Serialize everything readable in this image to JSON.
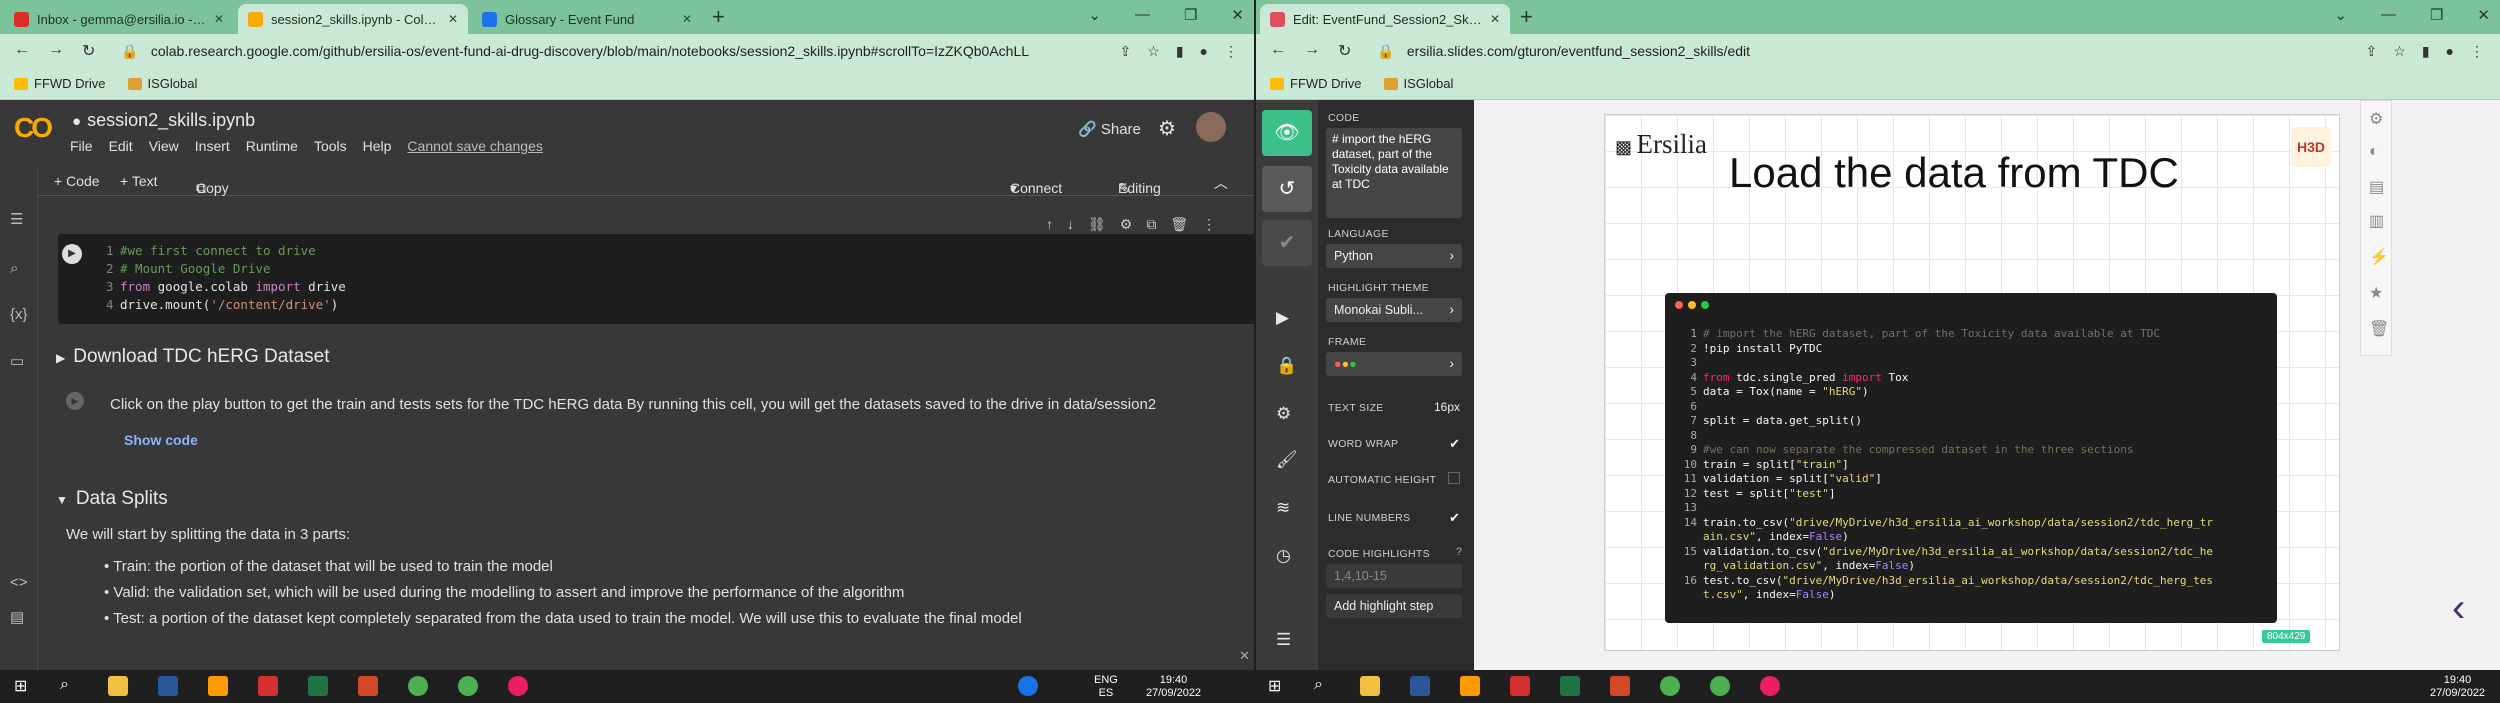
{
  "left_window": {
    "tabs": [
      {
        "title": "Inbox - gemma@ersilia.io - Ersil",
        "favicon_color": "#d93025"
      },
      {
        "title": "session2_skills.ipynb - Colaborat",
        "favicon_color": "#f9ab00"
      },
      {
        "title": "Glossary - Event Fund",
        "favicon_color": "#1a73e8"
      }
    ],
    "url": "colab.research.google.com/github/ersilia-os/event-fund-ai-drug-discovery/blob/main/notebooks/session2_skills.ipynb#scrollTo=IzZKQb0AchLL",
    "bookmarks": [
      "FFWD Drive",
      "ISGlobal"
    ],
    "colab": {
      "logo": "CO",
      "title": "session2_skills.ipynb",
      "menu": [
        "File",
        "Edit",
        "View",
        "Insert",
        "Runtime",
        "Tools",
        "Help"
      ],
      "unsaved": "Cannot save changes",
      "share": "Share",
      "toolbar": {
        "code": "+ Code",
        "text": "+ Text",
        "copy": "Copy to Drive",
        "connect": "Connect",
        "editing": "Editing"
      },
      "code_cell": [
        {
          "n": "1",
          "parts": [
            {
              "c": "cmt",
              "t": "#we first connect to drive"
            }
          ]
        },
        {
          "n": "2",
          "parts": [
            {
              "c": "cmt",
              "t": "# Mount Google Drive"
            }
          ]
        },
        {
          "n": "3",
          "parts": [
            {
              "c": "kw",
              "t": "from "
            },
            {
              "c": "",
              "t": "google.colab "
            },
            {
              "c": "kw",
              "t": "import "
            },
            {
              "c": "",
              "t": "drive"
            }
          ]
        },
        {
          "n": "4",
          "parts": [
            {
              "c": "",
              "t": "drive.mount("
            },
            {
              "c": "str",
              "t": "'/content/drive'"
            },
            {
              "c": "",
              "t": ")"
            }
          ]
        }
      ],
      "section1": "Download TDC hERG Dataset",
      "section1_text": "Click on the play button to get the train and tests sets for the TDC hERG data By running this cell, you will get the datasets saved to the drive in data/session2",
      "show_code": "Show code",
      "section2": "Data Splits",
      "section2_intro": "We will start by splitting the data in 3 parts:",
      "bullets": [
        "Train: the portion of the dataset that will be used to train the model",
        "Valid: the validation set, which will be used during the modelling to assert and improve the performance of the algorithm",
        "Test: a portion of the dataset kept completely separated from the data used to train the model. We will use this to evaluate the final model"
      ]
    }
  },
  "right_window": {
    "tab": "Edit: EventFund_Session2_Skills",
    "url": "ersilia.slides.com/gturon/eventfund_session2_skills/edit",
    "bookmarks": [
      "FFWD Drive",
      "ISGlobal"
    ],
    "props": {
      "code_label": "CODE",
      "code_preview": "# import the hERG dataset, part of the Toxicity data available at TDC",
      "language_label": "LANGUAGE",
      "language": "Python",
      "theme_label": "HIGHLIGHT THEME",
      "theme": "Monokai Subli...",
      "frame_label": "FRAME",
      "text_size_label": "TEXT SIZE",
      "text_size": "16px",
      "word_wrap": "WORD WRAP",
      "auto_height": "AUTOMATIC HEIGHT",
      "line_numbers": "LINE NUMBERS",
      "code_highlights": "CODE HIGHLIGHTS",
      "highlights_placeholder": "1,4,10-15",
      "add_step": "Add highlight step"
    },
    "slide": {
      "logo": "Ersilia",
      "badge": "H3D",
      "title": "Load the data from TDC",
      "size": "804x429",
      "code": [
        {
          "n": "1",
          "parts": [
            {
              "c": "mcm",
              "t": "# import the hERG dataset, part of the Toxicity data available at TDC"
            }
          ]
        },
        {
          "n": "2",
          "parts": [
            {
              "c": "",
              "t": "!pip install PyTDC"
            }
          ]
        },
        {
          "n": "3",
          "parts": []
        },
        {
          "n": "4",
          "parts": [
            {
              "c": "mkw",
              "t": "from "
            },
            {
              "c": "",
              "t": "tdc.single_pred "
            },
            {
              "c": "mkw",
              "t": "import "
            },
            {
              "c": "",
              "t": "Tox"
            }
          ]
        },
        {
          "n": "5",
          "parts": [
            {
              "c": "",
              "t": "data = Tox(name = "
            },
            {
              "c": "mst",
              "t": "\"hERG\""
            },
            {
              "c": "",
              "t": ")"
            }
          ]
        },
        {
          "n": "6",
          "parts": []
        },
        {
          "n": "7",
          "parts": [
            {
              "c": "",
              "t": "split = data.get_split()"
            }
          ]
        },
        {
          "n": "8",
          "parts": []
        },
        {
          "n": "9",
          "parts": [
            {
              "c": "mcm",
              "t": "#we can now separate the compressed dataset in the three sections"
            }
          ]
        },
        {
          "n": "10",
          "parts": [
            {
              "c": "",
              "t": "train = split["
            },
            {
              "c": "mst",
              "t": "\"train\""
            },
            {
              "c": "",
              "t": "]"
            }
          ]
        },
        {
          "n": "11",
          "parts": [
            {
              "c": "",
              "t": "validation = split["
            },
            {
              "c": "mst",
              "t": "\"valid\""
            },
            {
              "c": "",
              "t": "]"
            }
          ]
        },
        {
          "n": "12",
          "parts": [
            {
              "c": "",
              "t": "test = split["
            },
            {
              "c": "mst",
              "t": "\"test\""
            },
            {
              "c": "",
              "t": "]"
            }
          ]
        },
        {
          "n": "13",
          "parts": []
        },
        {
          "n": "14",
          "parts": [
            {
              "c": "",
              "t": "train.to_csv("
            },
            {
              "c": "mst",
              "t": "\"drive/MyDrive/h3d_ersilia_ai_workshop/data/session2/tdc_herg_tr"
            }
          ]
        },
        {
          "n": "",
          "parts": [
            {
              "c": "mst",
              "t": "ain.csv\""
            },
            {
              "c": "",
              "t": ", index="
            },
            {
              "c": "mnm",
              "t": "False"
            },
            {
              "c": "",
              "t": ")"
            }
          ]
        },
        {
          "n": "15",
          "parts": [
            {
              "c": "",
              "t": "validation.to_csv("
            },
            {
              "c": "mst",
              "t": "\"drive/MyDrive/h3d_ersilia_ai_workshop/data/session2/tdc_he"
            }
          ]
        },
        {
          "n": "",
          "parts": [
            {
              "c": "mst",
              "t": "rg_validation.csv\""
            },
            {
              "c": "",
              "t": ", index="
            },
            {
              "c": "mnm",
              "t": "False"
            },
            {
              "c": "",
              "t": ")"
            }
          ]
        },
        {
          "n": "16",
          "parts": [
            {
              "c": "",
              "t": "test.to_csv("
            },
            {
              "c": "mst",
              "t": "\"drive/MyDrive/h3d_ersilia_ai_workshop/data/session2/tdc_herg_tes"
            }
          ]
        },
        {
          "n": "",
          "parts": [
            {
              "c": "mst",
              "t": "t.csv\""
            },
            {
              "c": "",
              "t": ", index="
            },
            {
              "c": "mnm",
              "t": "False"
            },
            {
              "c": "",
              "t": ")"
            }
          ]
        }
      ]
    }
  },
  "taskbar": {
    "left_lang": "ENG\nES",
    "left_time": "19:40\n27/09/2022",
    "right_time": "19:40\n27/09/2022"
  }
}
